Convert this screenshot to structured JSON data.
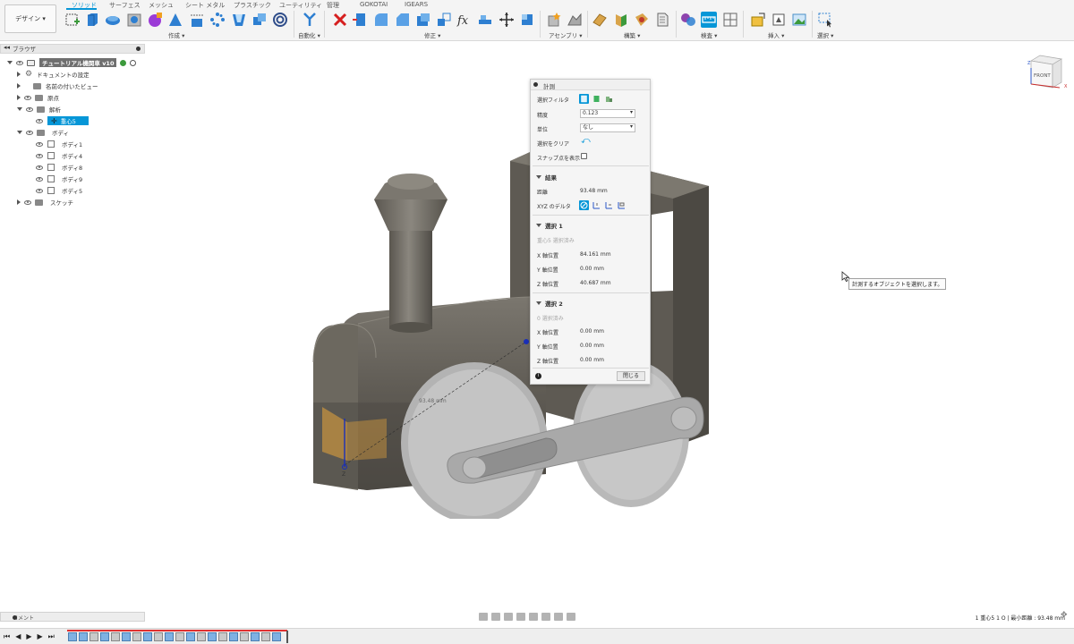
{
  "toolbar": {
    "design_button": "デザイン ▾",
    "tabs": [
      "ソリッド",
      "サーフェス",
      "メッシュ",
      "シート メタル",
      "プラスチック",
      "ユーティリティ",
      "管理",
      "GOKOTAI",
      "IGEARS"
    ],
    "active_tab": "ソリッド",
    "groups": [
      "作成 ▾",
      "自動化 ▾",
      "修正 ▾",
      "アセンブリ ▾",
      "構築 ▾",
      "検査 ▾",
      "挿入 ▾",
      "選択 ▾"
    ]
  },
  "browser": {
    "title": "ブラウザ",
    "items": [
      {
        "label": "チュートリアル機関車 v10"
      },
      {
        "label": "ドキュメントの設定"
      },
      {
        "label": "名前の付いたビュー"
      },
      {
        "label": "原点"
      },
      {
        "label": "解析"
      },
      {
        "label": "重心5"
      },
      {
        "label": "ボディ"
      },
      {
        "label": "ボディ1"
      },
      {
        "label": "ボディ4"
      },
      {
        "label": "ボディ8"
      },
      {
        "label": "ボディ9"
      },
      {
        "label": "ボディ5"
      },
      {
        "label": "スケッチ"
      }
    ]
  },
  "measure": {
    "title": "計測",
    "selection_filter_label": "選択フィルタ",
    "precision_label": "精度",
    "precision_value": "0.123",
    "unit_label": "単位",
    "unit_value": "なし",
    "clear_selection_label": "選択をクリア",
    "show_snap_label": "スナップ点を表示",
    "results_title": "結果",
    "distance_label": "距離",
    "distance_value": "93.48 mm",
    "xyz_delta_label": "XYZ のデルタ",
    "selection1_title": "選択 1",
    "selection1_status": "重心5 選択済み",
    "selection1_x_label": "X 軸位置",
    "selection1_x_value": "84.161 mm",
    "selection1_y_label": "Y 軸位置",
    "selection1_y_value": "0.00 mm",
    "selection1_z_label": "Z 軸位置",
    "selection1_z_value": "40.687 mm",
    "selection2_title": "選択 2",
    "selection2_status": "0 選択済み",
    "selection2_x_label": "X 軸位置",
    "selection2_x_value": "0.00 mm",
    "selection2_y_label": "Y 軸位置",
    "selection2_y_value": "0.00 mm",
    "selection2_z_label": "Z 軸位置",
    "selection2_z_value": "0.00 mm",
    "close_button": "閉じる"
  },
  "viewport": {
    "tooltip": "計測するオブジェクトを選択します。",
    "viewcube_label": "FRONT",
    "axis_z": "Z",
    "axis_x": "X",
    "dim_label": "93.48 mm"
  },
  "comments": {
    "label": "コメント"
  },
  "status": {
    "text": "1 重心5 1 O | 最小距離 : 93.48 mm"
  },
  "colors": {
    "accent": "#0696d7",
    "body": "#6e6a62",
    "wheel": "#b8b8b8"
  }
}
